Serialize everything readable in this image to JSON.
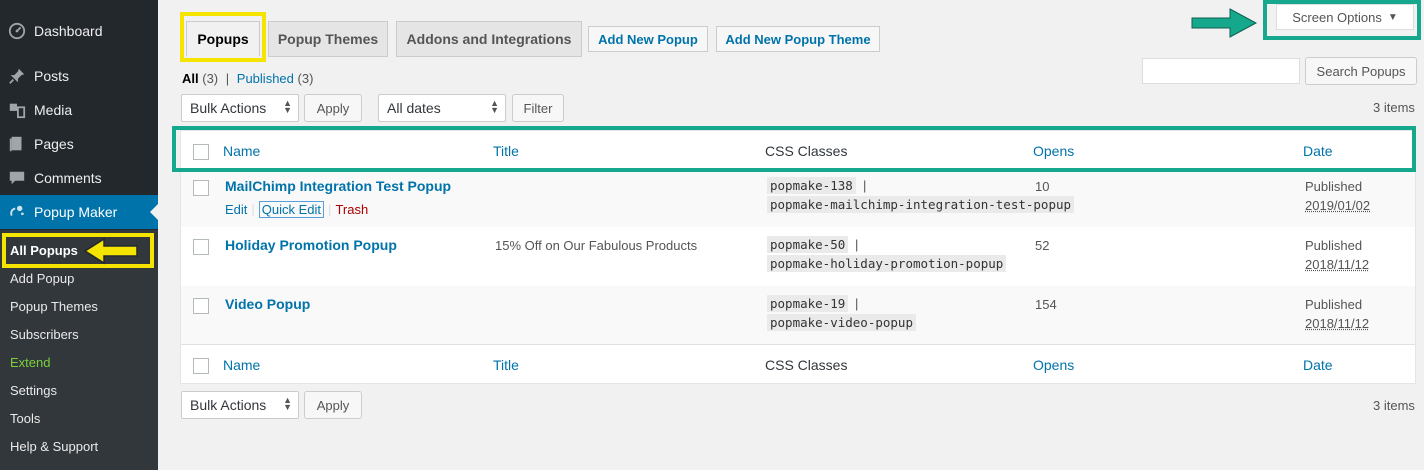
{
  "sidebar": {
    "items": [
      {
        "label": "Dashboard",
        "icon": "dashboard-icon"
      },
      {
        "label": "Posts",
        "icon": "pushpin-icon"
      },
      {
        "label": "Media",
        "icon": "media-icon"
      },
      {
        "label": "Pages",
        "icon": "pages-icon"
      },
      {
        "label": "Comments",
        "icon": "comments-icon"
      },
      {
        "label": "Popup Maker",
        "icon": "popup-maker-icon"
      }
    ],
    "submenu": [
      "All Popups",
      "Add Popup",
      "Popup Themes",
      "Subscribers",
      "Extend",
      "Settings",
      "Tools",
      "Help & Support"
    ]
  },
  "tabs": [
    "Popups",
    "Popup Themes",
    "Addons and Integrations"
  ],
  "buttons": {
    "add_new_popup": "Add New Popup",
    "add_new_popup_theme": "Add New Popup Theme",
    "screen_options": "Screen Options",
    "search_popups": "Search Popups",
    "apply": "Apply",
    "filter": "Filter"
  },
  "filters": {
    "all_label": "All",
    "all_count": "(3)",
    "separator": "|",
    "published_label": "Published",
    "published_count": "(3)"
  },
  "bulk_actions": "Bulk Actions",
  "date_filter": "All dates",
  "items_count": "3 items",
  "columns": [
    "Name",
    "Title",
    "CSS Classes",
    "Opens",
    "Date"
  ],
  "row_actions": {
    "edit": "Edit",
    "quick_edit": "Quick Edit",
    "trash": "Trash",
    "separator": "|"
  },
  "rows": [
    {
      "name": "MailChimp Integration Test Popup",
      "title": "",
      "css1": "popmake-138",
      "css2": "popmake-mailchimp-integration-test-popup",
      "opens": "10",
      "status": "Published",
      "date": "2019/01/02"
    },
    {
      "name": "Holiday Promotion Popup",
      "title": "15% Off on Our Fabulous Products",
      "css1": "popmake-50",
      "css2": "popmake-holiday-promotion-popup",
      "opens": "52",
      "status": "Published",
      "date": "2018/11/12"
    },
    {
      "name": "Video Popup",
      "title": "",
      "css1": "popmake-19",
      "css2": "popmake-video-popup",
      "opens": "154",
      "status": "Published",
      "date": "2018/11/12"
    }
  ],
  "colors": {
    "highlight_yellow": "#f5e400",
    "highlight_teal": "#16a88c",
    "link": "#0073aa",
    "sidebar": "#23282d"
  }
}
